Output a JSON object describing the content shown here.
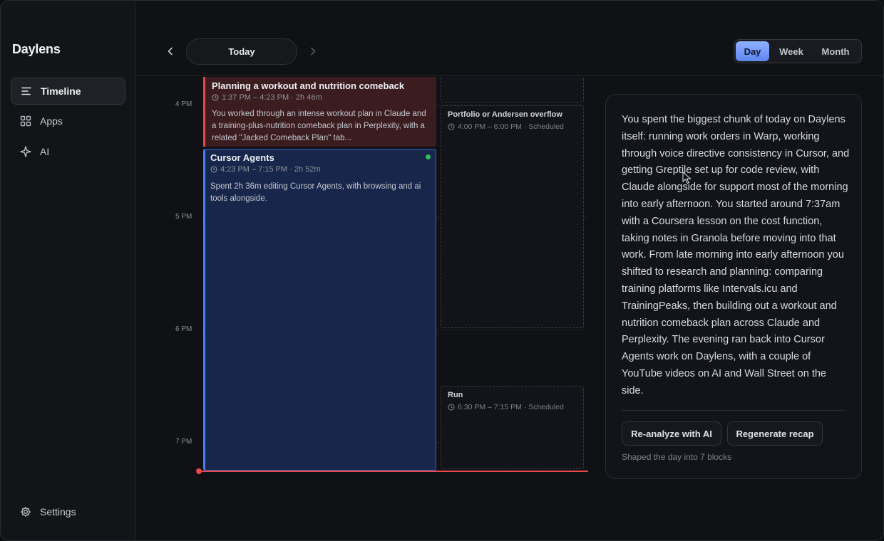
{
  "app": {
    "name": "Daylens"
  },
  "sidebar": {
    "items": [
      {
        "label": "Timeline",
        "icon": "timeline-icon",
        "active": true
      },
      {
        "label": "Apps",
        "icon": "apps-grid-icon",
        "active": false
      },
      {
        "label": "AI",
        "icon": "sparkle-icon",
        "active": false
      }
    ],
    "settings_label": "Settings"
  },
  "toolbar": {
    "today_label": "Today",
    "views": [
      {
        "label": "Day",
        "active": true
      },
      {
        "label": "Week",
        "active": false
      },
      {
        "label": "Month",
        "active": false
      }
    ]
  },
  "timeline": {
    "hours": [
      "4 PM",
      "5 PM",
      "6 PM",
      "7 PM"
    ],
    "blocks": [
      {
        "title": "Planning a workout and nutrition comeback",
        "time": "1:37 PM – 4:23 PM · 2h 46m",
        "description": "You worked through an intense workout plan in Claude and a training-plus-nutrition comeback plan in Perplexity, with a related \"Jacked Comeback Plan\" tab...",
        "color": "#e5484d"
      },
      {
        "title": "Cursor Agents",
        "time": "4:23 PM – 7:15 PM · 2h 52m",
        "description": "Spent 2h 36m editing Cursor Agents, with browsing and ai tools alongside.",
        "color": "#4f7ef0",
        "live": true
      }
    ],
    "scheduled": [
      {
        "title": "Portfolio or Andersen overflow",
        "time": "4:00 PM – 6:00 PM · Scheduled"
      },
      {
        "title": "Run",
        "time": "6:30 PM – 7:15 PM · Scheduled"
      }
    ]
  },
  "recap": {
    "text": "You spent the biggest chunk of today on Daylens itself: running work orders in Warp, working through voice directive consistency in Cursor, and getting Greptile set up for code review, with Claude alongside for support most of the morning into early afternoon. You started around 7:37am with a Coursera lesson on the cost function, taking notes in Granola before moving into that work. From late morning into early afternoon you shifted to research and planning: comparing training platforms like Intervals.icu and TrainingPeaks, then building out a workout and nutrition comeback plan across Claude and Perplexity. The evening ran back into Cursor Agents work on Daylens, with a couple of YouTube videos on AI and Wall Street on the side.",
    "reanalyze_label": "Re-analyze with AI",
    "regenerate_label": "Regenerate recap",
    "note": "Shaped the day into 7 blocks"
  }
}
